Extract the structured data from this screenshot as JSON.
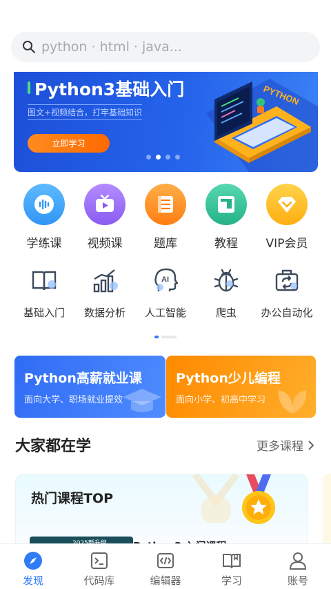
{
  "search": {
    "placeholder": "python · html · java..."
  },
  "banner": {
    "title": "Python3基础入门",
    "subtitle": "图文+视频结合，打牢基础知识",
    "button": "立即学习",
    "art_label": "PYTHON",
    "slide_index": 2,
    "slide_count": 4
  },
  "main_grid": [
    {
      "label": "学练课",
      "icon": "audio-wave-icon",
      "color": "#36a3f7"
    },
    {
      "label": "视频课",
      "icon": "tv-icon",
      "color": "#9b6cf6"
    },
    {
      "label": "题库",
      "icon": "book-stack-icon",
      "color": "#ff8a1e"
    },
    {
      "label": "教程",
      "icon": "document-icon",
      "color": "#33c29a"
    },
    {
      "label": "VIP会员",
      "icon": "diamond-icon",
      "color": "#ffb21c"
    }
  ],
  "topic_grid": [
    {
      "label": "基础入门",
      "icon": "open-book-icon"
    },
    {
      "label": "数据分析",
      "icon": "bar-chart-icon"
    },
    {
      "label": "人工智能",
      "icon": "ai-head-icon"
    },
    {
      "label": "爬虫",
      "icon": "bug-icon"
    },
    {
      "label": "办公自动化",
      "icon": "briefcase-icon"
    }
  ],
  "promos": [
    {
      "title": "Python高薪就业课",
      "subtitle": "面向大学、职场就业提效"
    },
    {
      "title": "Python少儿编程",
      "subtitle": "面向小学、初高中学习"
    }
  ],
  "section": {
    "title": "大家都在学",
    "more": "更多课程"
  },
  "hot": {
    "title": "热门课程TOP",
    "thumb_tag": "2025新升级",
    "course": "Python3 入门课程"
  },
  "tabs": [
    {
      "label": "发现",
      "icon": "compass-icon",
      "active": true
    },
    {
      "label": "代码库",
      "icon": "terminal-icon",
      "active": false
    },
    {
      "label": "编辑器",
      "icon": "code-icon",
      "active": false
    },
    {
      "label": "学习",
      "icon": "book-icon",
      "active": false
    },
    {
      "label": "账号",
      "icon": "user-icon",
      "active": false
    }
  ],
  "colors": {
    "accent": "#2f7cf6",
    "banner": "#2563eb",
    "orange": "#ff8a00"
  }
}
